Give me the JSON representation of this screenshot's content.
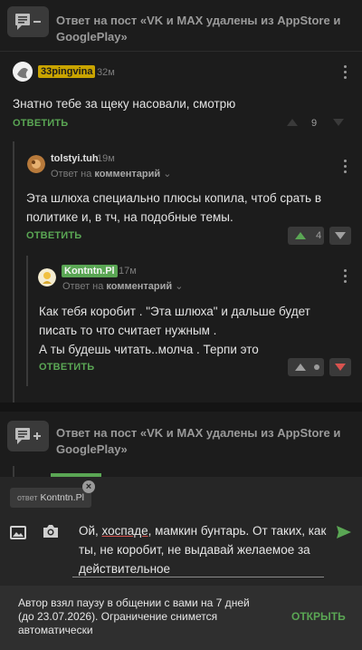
{
  "thread1": {
    "title": "Ответ на пост «VK и MAX удалены из AppStore и GooglePlay»",
    "icon": "comment-minus-icon"
  },
  "thread2": {
    "title": "Ответ на пост «VK и MAX удалены из AppStore и GooglePlay»",
    "icon": "comment-plus-icon"
  },
  "comments": [
    {
      "nick": "33pingvina",
      "nick_color": "#f2c200",
      "time": "32м",
      "text": "Знатно тебе за щеку насовали, смотрю",
      "reply_label": "ОТВЕТИТЬ",
      "votes": "9"
    },
    {
      "nick": "tolstyi.tuh",
      "time": "19м",
      "reply_to_prefix": "Ответ на",
      "reply_to_target": "комментарий",
      "text": "Эта шлюха специально плюсы копила, чтоб срать в политике и, в тч, на подобные темы.",
      "reply_label": "ОТВЕТИТЬ",
      "votes": "4"
    },
    {
      "nick": "Kontntn.Pl",
      "nick_color": "#5aa654",
      "time": "17м",
      "reply_to_prefix": "Ответ на",
      "reply_to_target": "комментарий",
      "text_lines": [
        "Как тебя коробит . \"Эта шлюха\" и дальше будет писать то что считает нужным .",
        "А ты будешь читать..молча . Терпи это"
      ],
      "reply_label": "ОТВЕТИТЬ"
    }
  ],
  "composer": {
    "reply_chip_prefix": "ответ",
    "reply_chip_name": "Kontntn.Pl",
    "text_before": "Ой, ",
    "text_misspelled": "хоспаде",
    "text_after": ", мамкин бунтарь. От таких, как ты, не коробит, не выдавай желаемое за действительное"
  },
  "notice": {
    "text": "Автор взял паузу в общении с вами на 7 дней (до 23.07.2026). Ограничение снимется автоматически",
    "button": "ОТКРЫТЬ"
  },
  "colors": {
    "accent": "#5aa654",
    "downvote_active": "#d9534f"
  }
}
